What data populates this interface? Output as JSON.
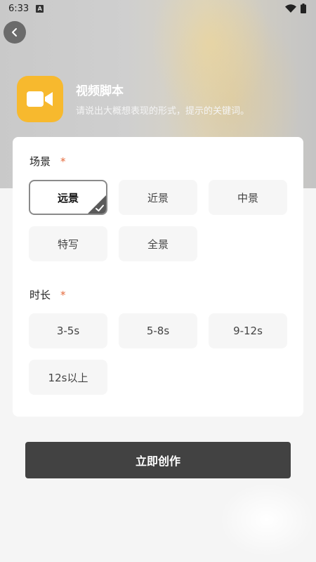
{
  "status_bar": {
    "time": "6:33",
    "notification_glyph": "A",
    "icons": [
      "notification-a-icon",
      "wifi-icon",
      "battery-icon"
    ]
  },
  "header": {
    "title": "视频脚本",
    "subtitle": "请说出大概想表现的形式，提示的关键词。",
    "app_icon": "video-camera-icon",
    "back_icon": "chevron-left-icon"
  },
  "form": {
    "scene": {
      "label": "场景",
      "required_mark": "*",
      "options": [
        "远景",
        "近景",
        "中景",
        "特写",
        "全景"
      ],
      "selected": "远景"
    },
    "duration": {
      "label": "时长",
      "required_mark": "*",
      "options": [
        "3-5s",
        "5-8s",
        "9-12s",
        "12s以上"
      ],
      "selected": ""
    }
  },
  "actions": {
    "create_label": "立即创作"
  },
  "colors": {
    "accent_icon": "#f7b92e",
    "required": "#e56a3c",
    "button": "#424242"
  }
}
